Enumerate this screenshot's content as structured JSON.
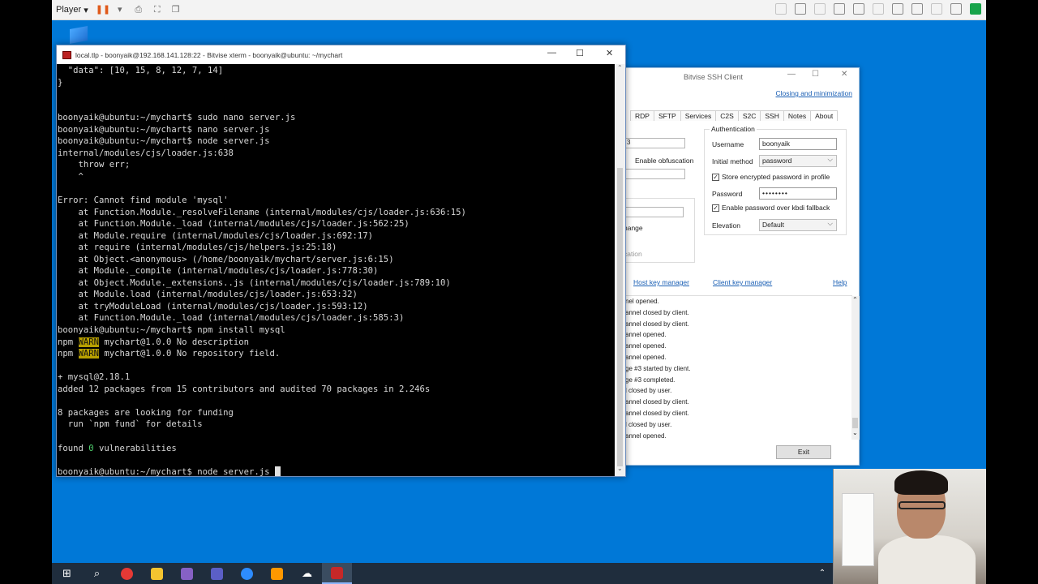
{
  "player_bar": {
    "label": "Player",
    "icons": [
      "pause-icon",
      "send-keys-icon",
      "fullscreen-icon",
      "unity-icon"
    ]
  },
  "xterm": {
    "title": "local.tlp - boonyaik@192.168.141.128:22 - Bitvise xterm - boonyaik@ubuntu: ~/mychart",
    "lines": [
      "  \"data\": [10, 15, 8, 12, 7, 14]",
      "}",
      "",
      "",
      "boonyaik@ubuntu:~/mychart$ sudo nano server.js",
      "boonyaik@ubuntu:~/mychart$ nano server.js",
      "boonyaik@ubuntu:~/mychart$ node server.js",
      "internal/modules/cjs/loader.js:638",
      "    throw err;",
      "    ^",
      "",
      "Error: Cannot find module 'mysql'",
      "    at Function.Module._resolveFilename (internal/modules/cjs/loader.js:636:15)",
      "    at Function.Module._load (internal/modules/cjs/loader.js:562:25)",
      "    at Module.require (internal/modules/cjs/loader.js:692:17)",
      "    at require (internal/modules/cjs/helpers.js:25:18)",
      "    at Object.<anonymous> (/home/boonyaik/mychart/server.js:6:15)",
      "    at Module._compile (internal/modules/cjs/loader.js:778:30)",
      "    at Object.Module._extensions..js (internal/modules/cjs/loader.js:789:10)",
      "    at Module.load (internal/modules/cjs/loader.js:653:32)",
      "    at tryModuleLoad (internal/modules/cjs/loader.js:593:12)",
      "    at Function.Module._load (internal/modules/cjs/loader.js:585:3)",
      "boonyaik@ubuntu:~/mychart$ npm install mysql"
    ],
    "warn_lines": [
      {
        "prefix": "npm ",
        "tag": "WARN",
        "text": " mychart@1.0.0 No description"
      },
      {
        "prefix": "npm ",
        "tag": "WARN",
        "text": " mychart@1.0.0 No repository field."
      }
    ],
    "lines_after": [
      "",
      "+ mysql@2.18.1",
      "added 12 packages from 15 contributors and audited 70 packages in 2.246s",
      "",
      "8 packages are looking for funding",
      "  run `npm fund` for details",
      ""
    ],
    "found_prefix": "found ",
    "found_count": "0",
    "found_suffix": " vulnerabilities",
    "prompt_final": "boonyaik@ubuntu:~/mychart$ node server.js "
  },
  "ssh_client": {
    "title": "Bitvise SSH Client",
    "closing_link": "Closing and minimization",
    "tabs": [
      "RDP",
      "SFTP",
      "Services",
      "C2S",
      "S2C",
      "SSH",
      "Notes",
      "About"
    ],
    "auth": {
      "group_title": "Authentication",
      "username_label": "Username",
      "username_value": "boonyaik",
      "initial_method_label": "Initial method",
      "initial_method_value": "password",
      "store_password_label": "Store encrypted password in profile",
      "password_label": "Password",
      "password_value": "••••••••",
      "kbdi_label": "Enable password over kbdi fallback",
      "elevation_label": "Elevation",
      "elevation_value": "Default"
    },
    "left_partial": {
      "field_value": "3",
      "obfuscation_label": "Enable obfuscation",
      "manage_label": "nange",
      "cation_label": "cation"
    },
    "links": {
      "host_key": "Host key manager",
      "client_key": "Client key manager",
      "help": "Help"
    },
    "log": [
      "nel opened.",
      "annel closed by client.",
      "annel closed by client.",
      "annel opened.",
      "annel opened.",
      "annel opened.",
      "ge #3 started by client.",
      "ge #3 completed.",
      "l closed by user.",
      "annel closed by client.",
      "annel closed by client.",
      "l closed by user.",
      "annel opened."
    ],
    "exit_label": "Exit"
  },
  "taskbar": {
    "items": [
      "start-icon",
      "search-icon",
      "chrome-icon",
      "file-explorer-icon",
      "visual-studio-icon",
      "teams-icon",
      "zoom-icon",
      "sublime-icon",
      "cloud-icon",
      "bitvise-icon"
    ],
    "colors": {
      "chrome": "#e53935",
      "file_explorer": "#f4c430",
      "visual_studio": "#8661c5",
      "teams": "#5b5fc7",
      "zoom": "#2d8cff",
      "sublime": "#ff9800",
      "bitvise": "#c62828"
    }
  }
}
